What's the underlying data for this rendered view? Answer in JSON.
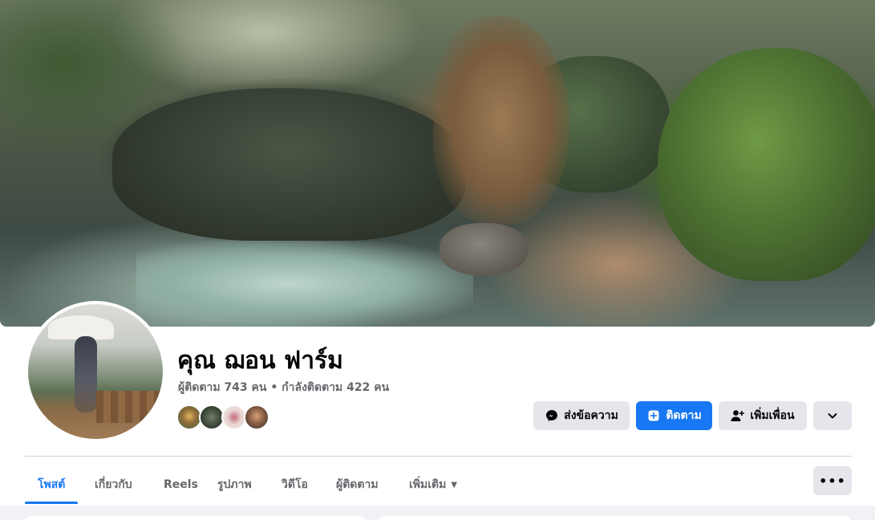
{
  "profile": {
    "name": "คุณ ฌอน ฟาร์ม",
    "stats": "ผู้ติดตาม 743 คน • กำลังติดตาม 422 คน"
  },
  "actions": {
    "message_label": "ส่งข้อความ",
    "follow_label": "ติดตาม",
    "add_friend_label": "เพิ่มเพื่อน"
  },
  "tabs": [
    {
      "label": "โพสต์",
      "active": true
    },
    {
      "label": "เกี่ยวกับ"
    },
    {
      "label": "Reels"
    },
    {
      "label": "รูปภาพ"
    },
    {
      "label": "วิดีโอ"
    },
    {
      "label": "ผู้ติดตาม"
    },
    {
      "label": "เพิ่มเติม"
    }
  ],
  "icons": {
    "message": "messenger-icon",
    "follow": "follow-icon",
    "add_friend": "add-friend-icon",
    "more": "chevron-down-icon",
    "overflow": "more-dots-icon"
  },
  "colors": {
    "accent": "#1877f2",
    "button_grey": "#e4e6eb",
    "secondary_text": "#65676b",
    "page_bg": "#f0f2f5"
  }
}
